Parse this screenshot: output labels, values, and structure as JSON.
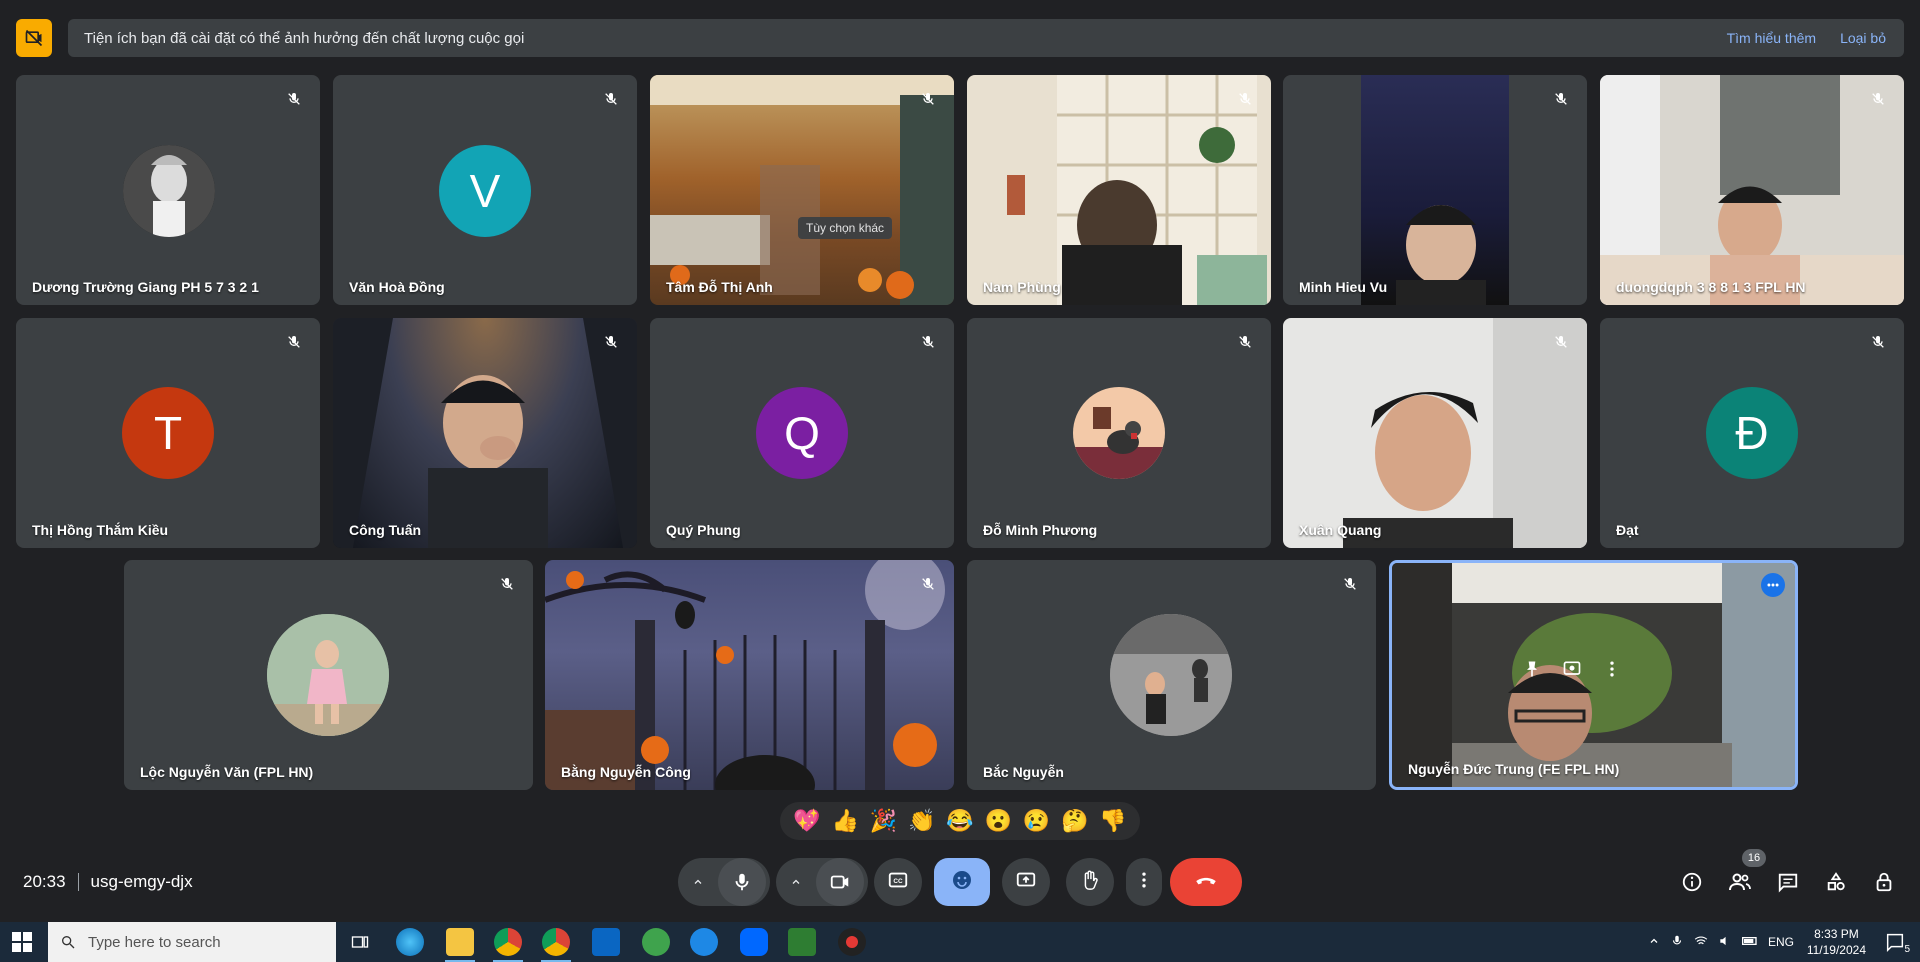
{
  "banner": {
    "message": "Tiện ích bạn đã cài đặt có thể ảnh hưởng đến chất lượng cuộc gọi",
    "learn_more": "Tìm hiểu thêm",
    "dismiss": "Loại bỏ"
  },
  "participants": [
    {
      "name": "Dương Trường Giang PH 5 7 3 2 1",
      "type": "photo-avatar"
    },
    {
      "name": "Văn Hoà Đồng",
      "type": "letter",
      "initial": "V",
      "color": "#12a4b5"
    },
    {
      "name": "Tâm Đỗ Thị Anh",
      "type": "video"
    },
    {
      "name": "Nam Phùng",
      "type": "video"
    },
    {
      "name": "Minh Hieu Vu",
      "type": "video"
    },
    {
      "name": "duongdqph 3 8 8 1 3 FPL HN",
      "type": "video"
    },
    {
      "name": "Thị Hồng Thắm Kiều",
      "type": "letter",
      "initial": "T",
      "color": "#c5380f"
    },
    {
      "name": "Công Tuấn",
      "type": "video"
    },
    {
      "name": "Quý Phung",
      "type": "letter",
      "initial": "Q",
      "color": "#7b1fa2"
    },
    {
      "name": "Đỗ Minh Phương",
      "type": "photo-avatar"
    },
    {
      "name": "Xuân Quang",
      "type": "video"
    },
    {
      "name": "Đạt",
      "type": "letter",
      "initial": "Đ",
      "color": "#0b8377"
    },
    {
      "name": "Lộc Nguyễn Văn (FPL HN)",
      "type": "photo-avatar"
    },
    {
      "name": "Bằng Nguyễn Công",
      "type": "video"
    },
    {
      "name": "Bắc Nguyễn",
      "type": "photo-avatar"
    },
    {
      "name": "Nguyễn Đức Trung (FE FPL HN)",
      "type": "video",
      "pinned_highlight": true
    }
  ],
  "tooltip": "Tùy chọn khác",
  "reactions": [
    "💖",
    "👍",
    "🎉",
    "👏",
    "😂",
    "😮",
    "😢",
    "🤔",
    "👎"
  ],
  "meeting": {
    "time": "20:33",
    "code": "usg-emgy-djx"
  },
  "people_count": "16",
  "taskbar": {
    "search_placeholder": "Type here to search",
    "lang": "ENG",
    "time": "8:33 PM",
    "date": "11/19/2024",
    "notifications": "5"
  }
}
